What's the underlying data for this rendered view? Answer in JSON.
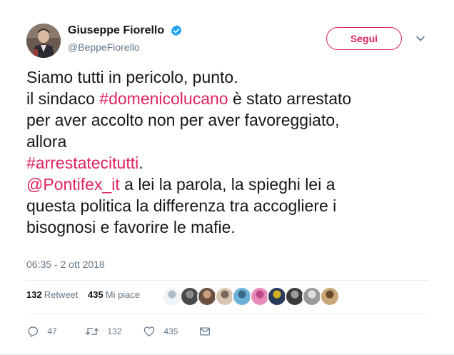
{
  "header": {
    "full_name": "Giuseppe Fiorello",
    "screen_name": "@BeppeFiorello",
    "verified_icon": "verified-badge-icon",
    "follow_label": "Segui",
    "caret_icon": "chevron-down-icon"
  },
  "tweet": {
    "lines": [
      [
        {
          "t": "text",
          "v": "Siamo tutti in pericolo, punto."
        }
      ],
      [
        {
          "t": "text",
          "v": "il sindaco "
        },
        {
          "t": "hashtag",
          "v": "#domenicolucano"
        },
        {
          "t": "text",
          "v": " è stato arrestato"
        }
      ],
      [
        {
          "t": "text",
          "v": "per aver accolto non per aver favoreggiato,"
        }
      ],
      [
        {
          "t": "text",
          "v": "allora"
        }
      ],
      [
        {
          "t": "hashtag",
          "v": "#arrestatecitutti"
        },
        {
          "t": "text",
          "v": "."
        }
      ],
      [
        {
          "t": "mention",
          "v": "@Pontifex_it"
        },
        {
          "t": "text",
          "v": " a lei la parola, la spieghi lei a"
        }
      ],
      [
        {
          "t": "text",
          "v": "questa politica la differenza tra accogliere i"
        }
      ],
      [
        {
          "t": "text",
          "v": "bisognosi e favorire le mafie."
        }
      ]
    ],
    "timestamp": "06:35 - 2 ott 2018"
  },
  "stats": {
    "retweet_count": "132",
    "retweet_label": "Retweet",
    "like_count": "435",
    "like_label": "Mi piace",
    "liker_avatars": [
      "avatar-1",
      "avatar-2",
      "avatar-3",
      "avatar-4",
      "avatar-5",
      "avatar-6",
      "avatar-7",
      "avatar-8",
      "avatar-9",
      "avatar-10"
    ]
  },
  "actions": {
    "reply_count": "47",
    "retweet_count": "132",
    "like_count": "435",
    "reply_icon": "reply-icon",
    "retweet_icon": "retweet-icon",
    "like_icon": "heart-icon",
    "dm_icon": "envelope-icon"
  },
  "colors": {
    "accent": "#e0245e",
    "secondary_text": "#657786",
    "verified": "#1da1f2"
  }
}
